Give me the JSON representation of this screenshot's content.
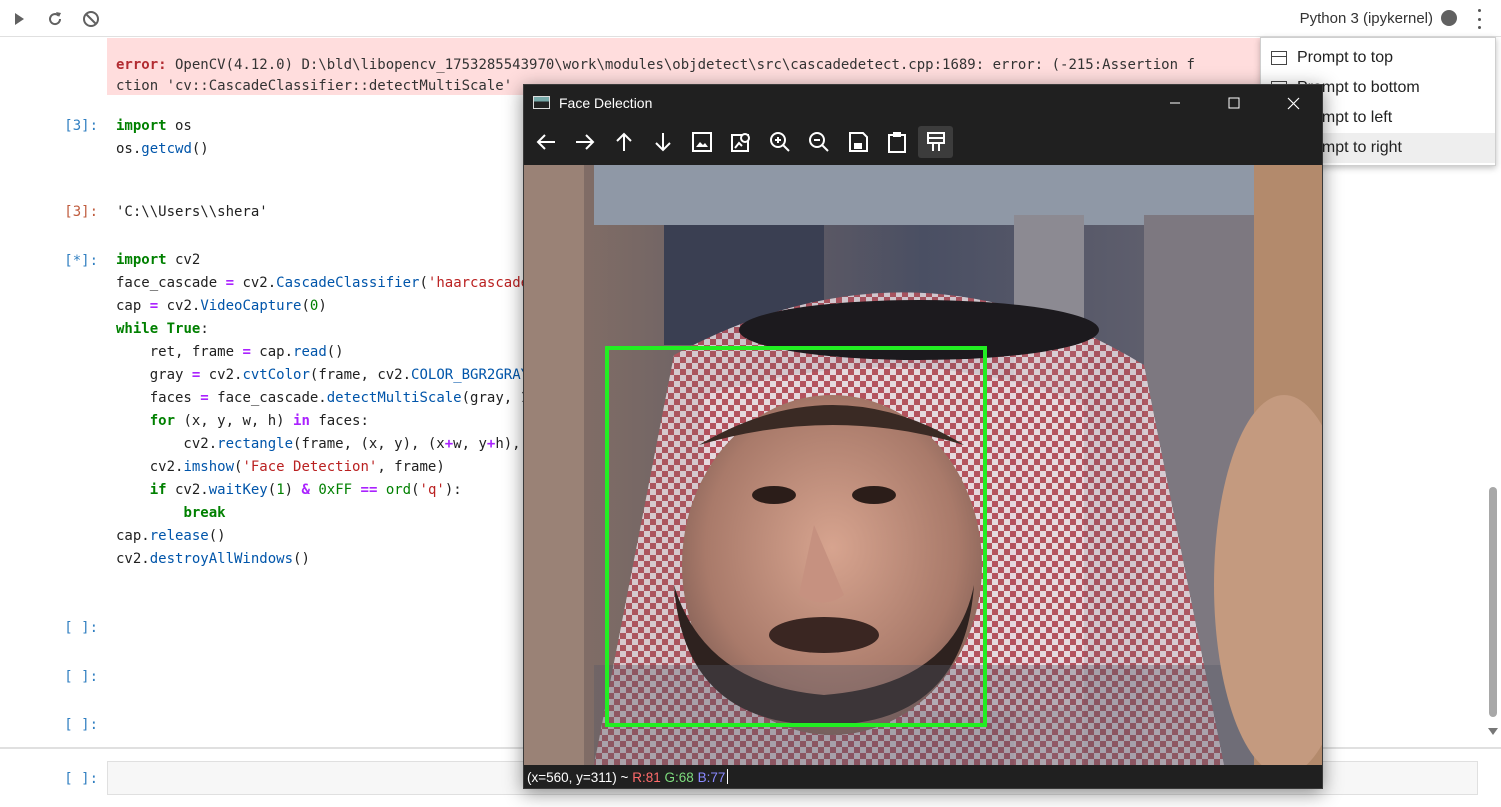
{
  "toolbar": {
    "run_icon": "play-icon",
    "restart_icon": "restart-icon",
    "interrupt_icon": "stop-icon",
    "kernel_label": "Python 3 (ipykernel)",
    "kernel_status": "busy",
    "menu_icon": "kebab-icon"
  },
  "error_output": {
    "prefix": "error:",
    "line1_rest": " OpenCV(4.12.0) D:\\bld\\libopencv_1753285543970\\work\\modules\\objdetect\\src\\cascadedetect.cpp:1689: error: (-215:Assertion f",
    "line2": "ction 'cv::CascadeClassifier::detectMultiScale'"
  },
  "cells": {
    "cell3": {
      "prompt": "[3]:",
      "line1_kw": "import",
      "line1_rest": " os",
      "line2_a": "os.",
      "line2_fn": "getcwd",
      "line2_b": "()",
      "out_prompt": "[3]:",
      "output": "'C:\\\\Users\\\\shera'"
    },
    "cell_running": {
      "prompt": "[*]:"
    },
    "empty_prompt": "[ ]:"
  },
  "context_menu": {
    "items": [
      "Prompt to top",
      "Prompt to bottom",
      "Prompt to left",
      "Prompt to right"
    ],
    "hovered_index": 3
  },
  "cv_window": {
    "title": "Face Delection",
    "toolbar_icons": [
      "arrow-left-icon",
      "arrow-right-icon",
      "arrow-up-icon",
      "arrow-down-icon",
      "image-icon",
      "image-search-icon",
      "zoom-in-icon",
      "zoom-out-icon",
      "save-icon",
      "clipboard-icon",
      "properties-icon"
    ],
    "status_coords": "(x=560, y=311) ~",
    "status_r": "R:81",
    "status_g": "G:68",
    "status_b": "B:77",
    "box_color": "#22ee22"
  },
  "colors": {
    "error_bg": "#ffdddd",
    "error_text": "#b22b31",
    "keyword": "#008000",
    "prompt_in": "#307fc1",
    "prompt_out": "#bf5b3d"
  }
}
